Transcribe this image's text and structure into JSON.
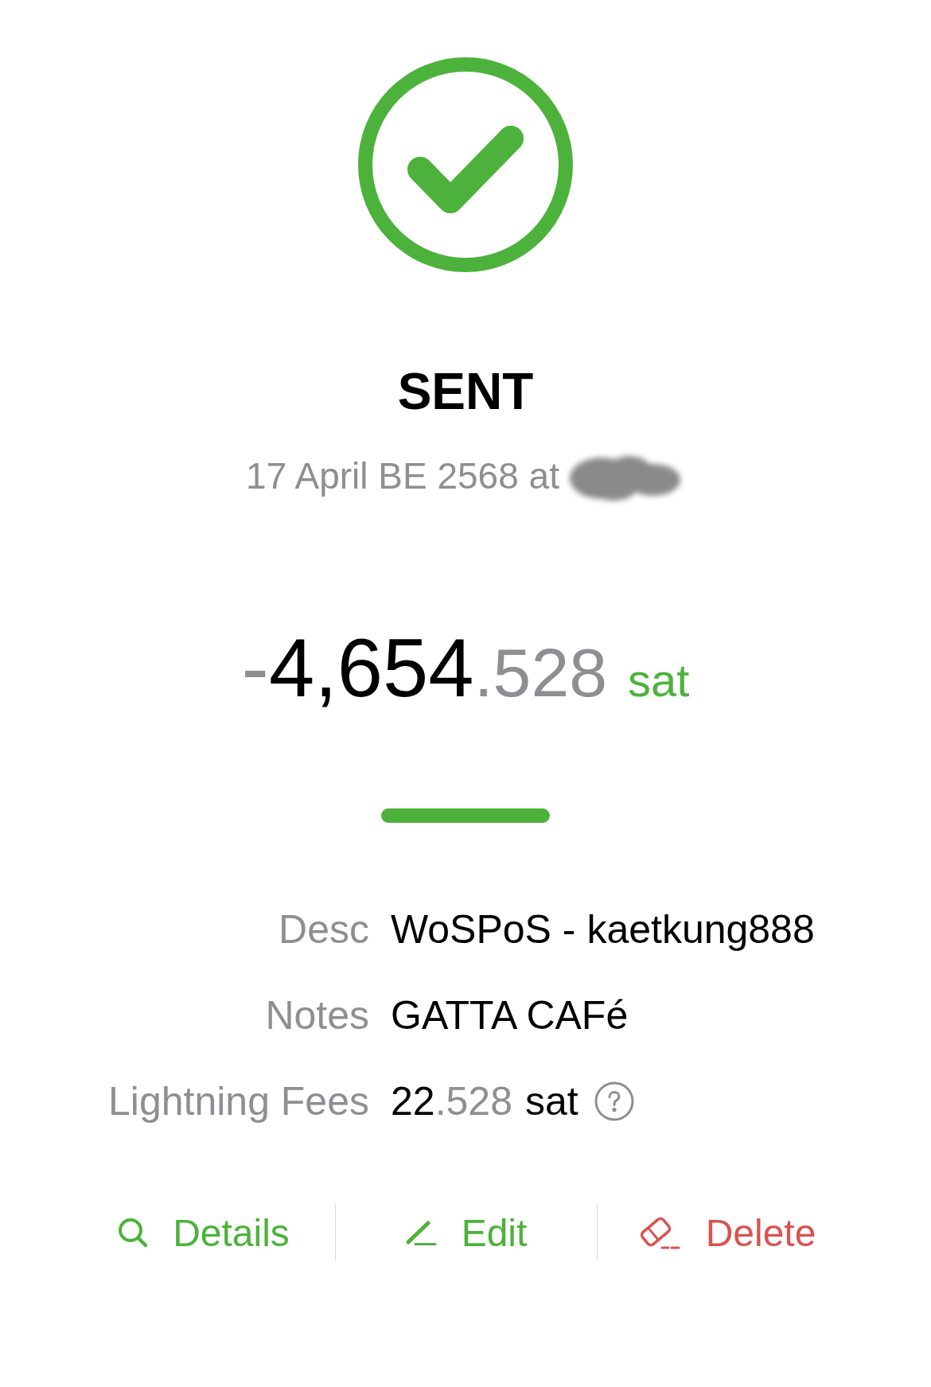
{
  "status": {
    "kind": "success"
  },
  "title": "SENT",
  "timestamp": {
    "text": "17 April BE 2568 at",
    "redacted": true
  },
  "amount": {
    "sign": "-",
    "integer": "4,654",
    "fraction": ".528",
    "unit": "sat"
  },
  "details": [
    {
      "kind": "text",
      "label": "Desc",
      "value": "WoSPoS - kaetkung888"
    },
    {
      "kind": "text",
      "label": "Notes",
      "value": "GATTA CAFé"
    },
    {
      "kind": "amount",
      "label": "Lightning Fees",
      "integer": "22",
      "fraction": ".528",
      "unit": "sat",
      "help": true
    }
  ],
  "actions": [
    {
      "kind": "details",
      "label": "Details"
    },
    {
      "kind": "edit",
      "label": "Edit"
    },
    {
      "kind": "delete",
      "label": "Delete"
    }
  ]
}
